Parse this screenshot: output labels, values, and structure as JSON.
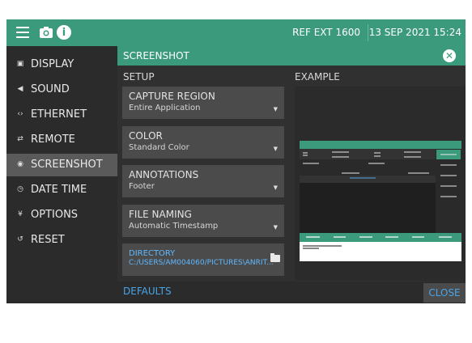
{
  "topbar": {
    "icons": [
      "menu-icon",
      "camera-icon",
      "info-icon"
    ],
    "reference": "REF EXT 1600",
    "datetime": "13 SEP 2021 15:24"
  },
  "sidebar": {
    "items": [
      {
        "label": "DISPLAY",
        "icon": "display-icon",
        "active": false
      },
      {
        "label": "SOUND",
        "icon": "sound-icon",
        "active": false
      },
      {
        "label": "ETHERNET",
        "icon": "ethernet-icon",
        "active": false
      },
      {
        "label": "REMOTE",
        "icon": "remote-icon",
        "active": false
      },
      {
        "label": "SCREENSHOT",
        "icon": "camera-icon",
        "active": true
      },
      {
        "label": "DATE TIME",
        "icon": "clock-icon",
        "active": false
      },
      {
        "label": "OPTIONS",
        "icon": "options-icon",
        "active": false
      },
      {
        "label": "RESET",
        "icon": "reset-icon",
        "active": false
      }
    ]
  },
  "panel": {
    "title": "SCREENSHOT",
    "setup_header": "SETUP",
    "example_header": "EXAMPLE",
    "settings": [
      {
        "label": "CAPTURE REGION",
        "value": "Entire Application"
      },
      {
        "label": "COLOR",
        "value": "Standard Color"
      },
      {
        "label": "ANNOTATIONS",
        "value": "Footer"
      },
      {
        "label": "FILE NAMING",
        "value": "Automatic Timestamp"
      }
    ],
    "directory": {
      "label": "DIRECTORY",
      "value": "C:/USERS/AM004060/PICTURES\\ANRIT..."
    },
    "defaults_label": "DEFAULTS",
    "close_label": "CLOSE"
  },
  "colors": {
    "accent": "#3c9a7c",
    "link": "#49a5e8",
    "background": "#2b2b2b",
    "card": "#4b4b4b"
  }
}
